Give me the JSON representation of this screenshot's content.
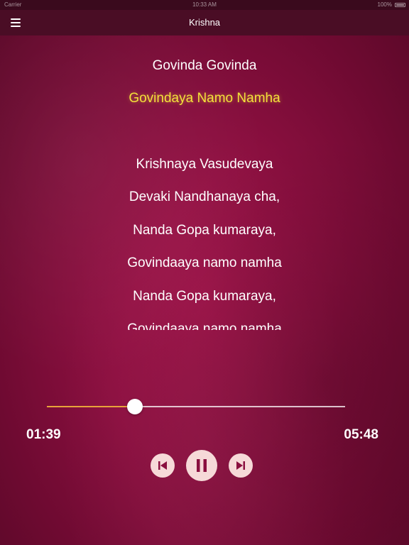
{
  "status_bar": {
    "carrier": "Carrier",
    "time": "10:33 AM",
    "battery": "100%"
  },
  "header": {
    "title": "Krishna"
  },
  "lyrics": {
    "lines": [
      "Govinda Govinda",
      "Govindaya Namo Namha",
      "Krishnaya Vasudevaya",
      "Devaki Nandhanaya cha,",
      "Nanda Gopa kumaraya,",
      "Govindaaya namo namha",
      "Nanda Gopa kumaraya,",
      "Govindaaya namo namha"
    ],
    "active_index": 1
  },
  "player": {
    "elapsed": "01:39",
    "duration": "05:48",
    "progress_fraction": 0.296
  },
  "colors": {
    "accent": "#e8a33a",
    "active_lyric": "#f3e13a",
    "background": "#8a0f3f",
    "control_bg": "#f6d9d8",
    "control_icon": "#8a0f3f"
  },
  "icons": {
    "menu": "hamburger-icon",
    "previous": "skip-previous-icon",
    "play_pause": "pause-icon",
    "next": "skip-next-icon"
  }
}
